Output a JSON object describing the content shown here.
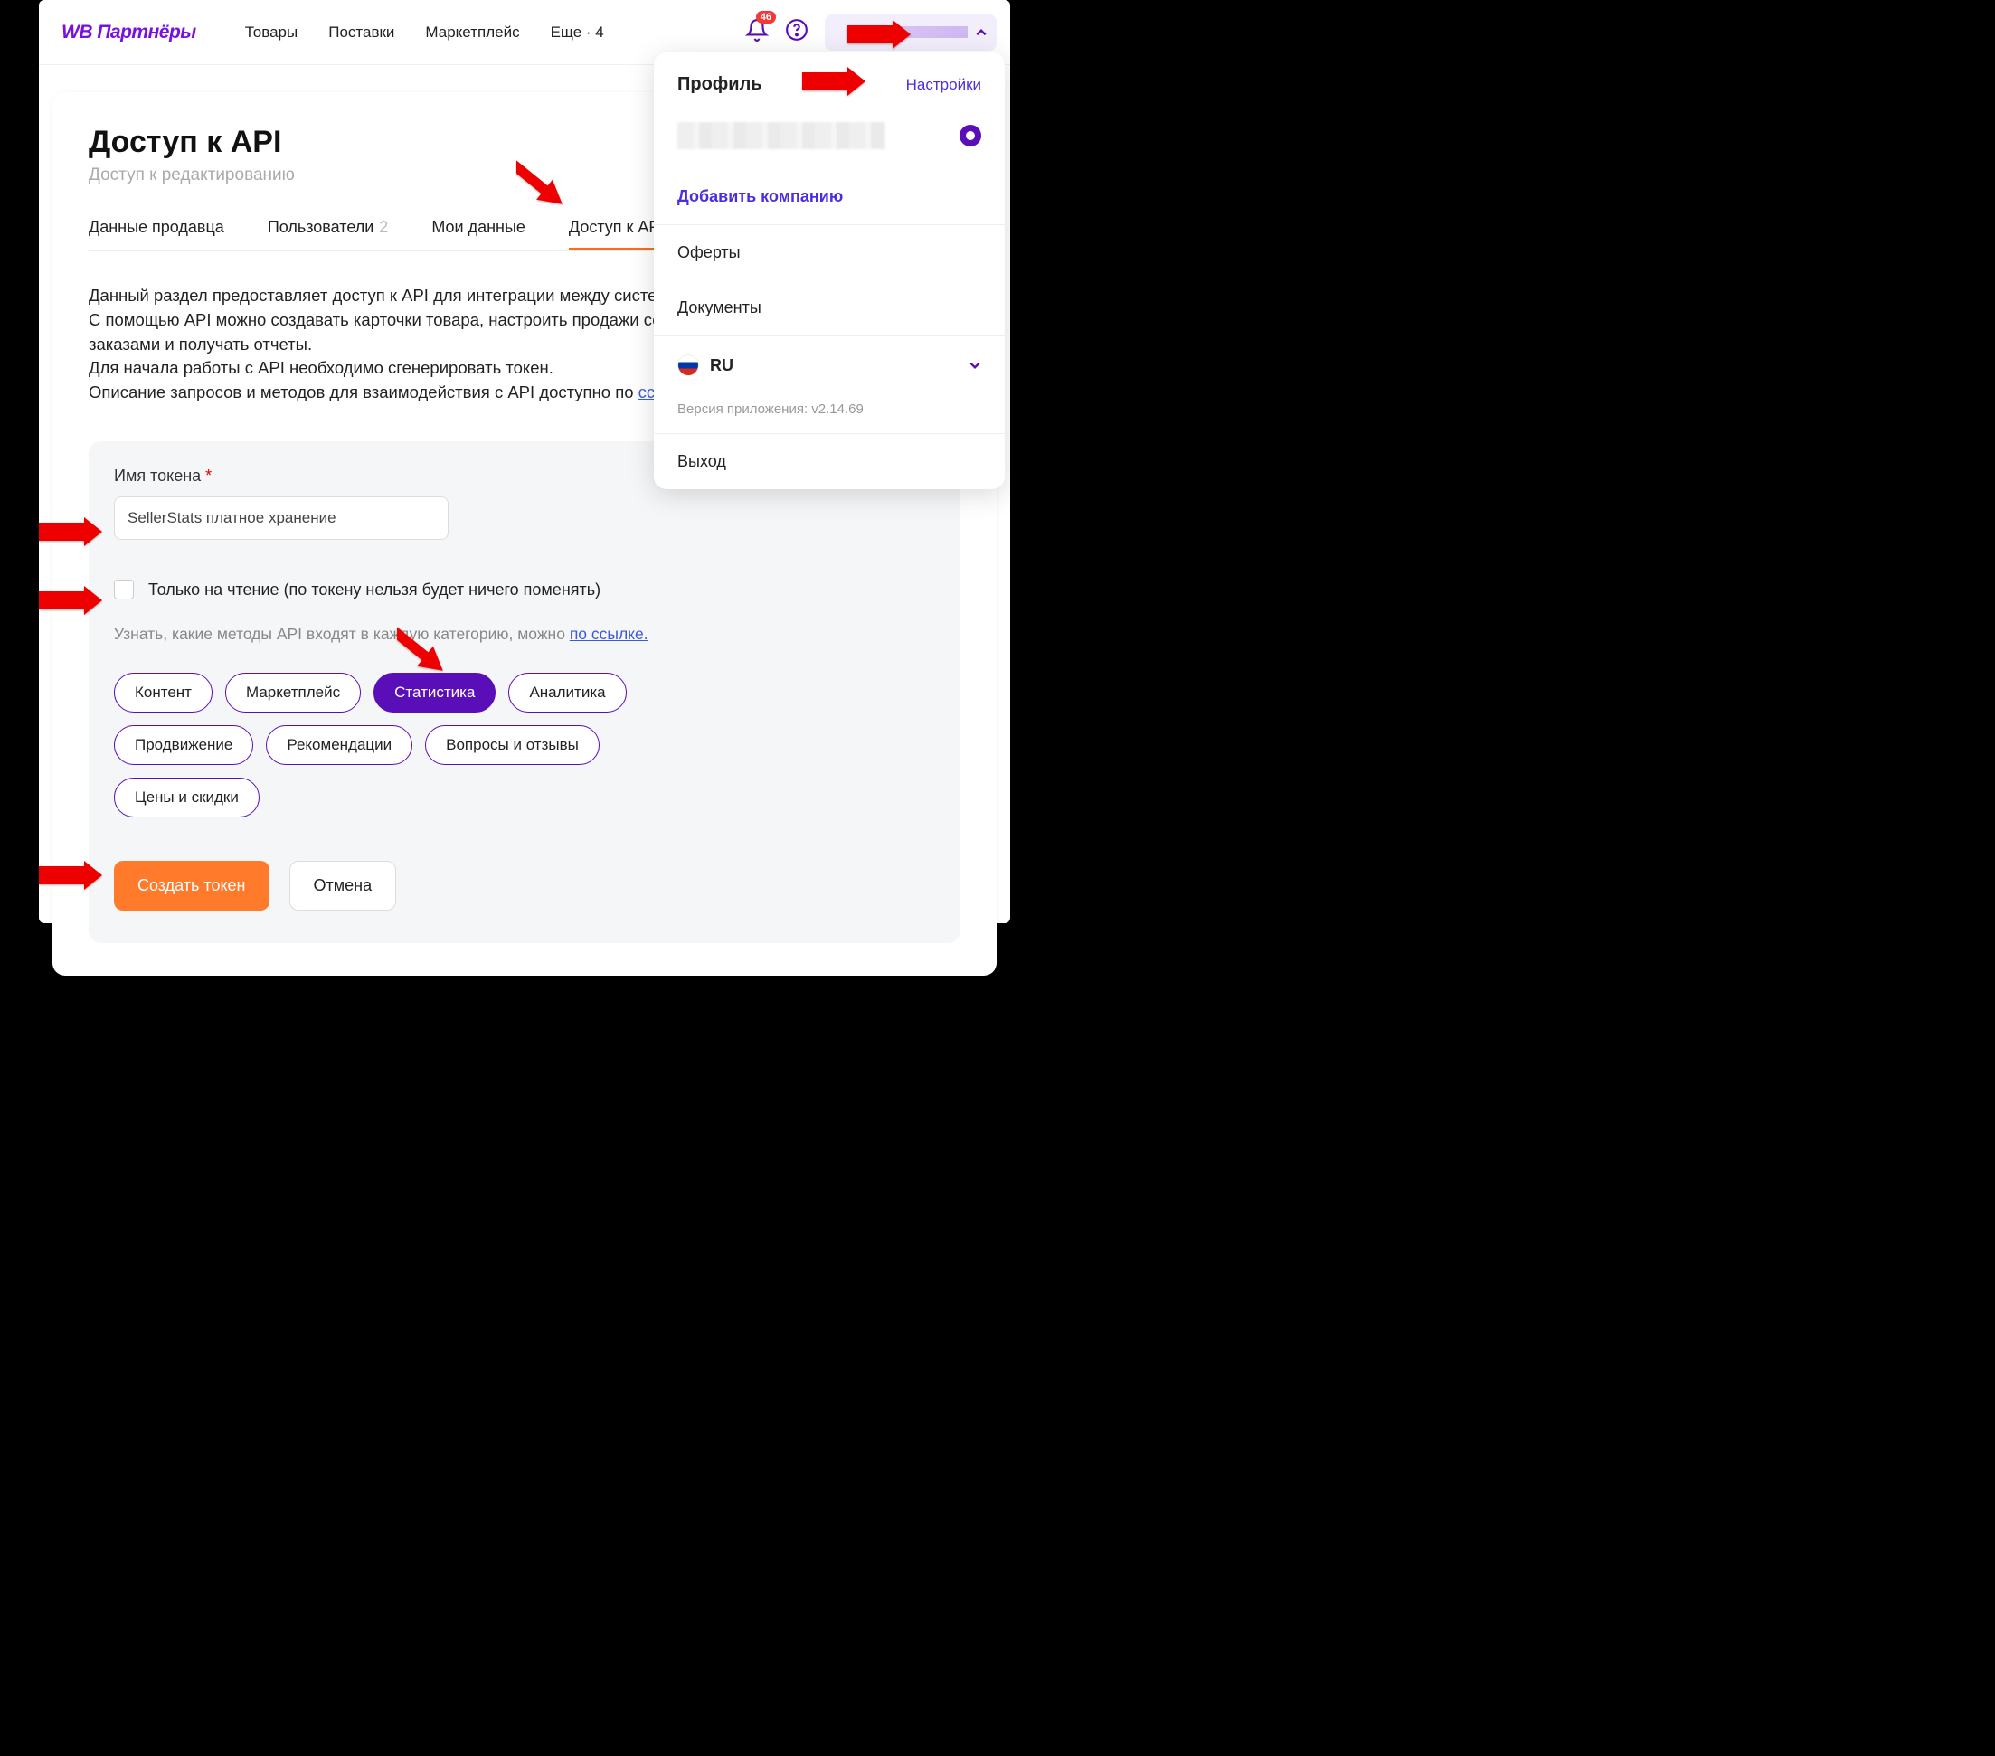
{
  "header": {
    "logo": "WB Партнёры",
    "nav": [
      "Товары",
      "Поставки",
      "Маркетплейс",
      "Еще · 4"
    ],
    "badge": "46"
  },
  "dropdown": {
    "title": "Профиль",
    "settings": "Настройки",
    "add_company": "Добавить компанию",
    "items": [
      "Оферты",
      "Документы"
    ],
    "lang": "RU",
    "version": "Версия приложения: v2.14.69",
    "logout": "Выход"
  },
  "page": {
    "title": "Доступ к API",
    "subtitle": "Доступ к редактированию",
    "tabs": [
      {
        "label": "Данные продавца",
        "count": ""
      },
      {
        "label": "Пользователи",
        "count": "2"
      },
      {
        "label": "Мои данные",
        "count": ""
      },
      {
        "label": "Доступ к API",
        "count": ""
      }
    ],
    "desc_1": "Данный раздел предоставляет доступ к API для интеграции между системой продавца и порталом продавцов.",
    "desc_2": "С помощью API можно создавать карточки товара, настроить продажи со склада продавца, работать с заказами и получать отчеты.",
    "desc_3": "Для начала работы с API необходимо сгенерировать токен.",
    "desc_4_pre": "Описание запросов и методов для взаимодействия с API доступно по ",
    "desc_4_link": "ссылке."
  },
  "form": {
    "token_label": "Имя токена",
    "token_value": "SellerStats платное хранение",
    "readonly_label": "Только на чтение (по токену нельзя будет ничего поменять)",
    "hint_pre": "Узнать, какие методы API входят в каждую категорию, можно ",
    "hint_link": "по ссылке.",
    "chips": [
      "Контент",
      "Маркетплейс",
      "Статистика",
      "Аналитика",
      "Продвижение",
      "Рекомендации",
      "Вопросы и отзывы",
      "Цены и скидки"
    ],
    "chip_active": 2,
    "create": "Создать токен",
    "cancel": "Отмена"
  }
}
